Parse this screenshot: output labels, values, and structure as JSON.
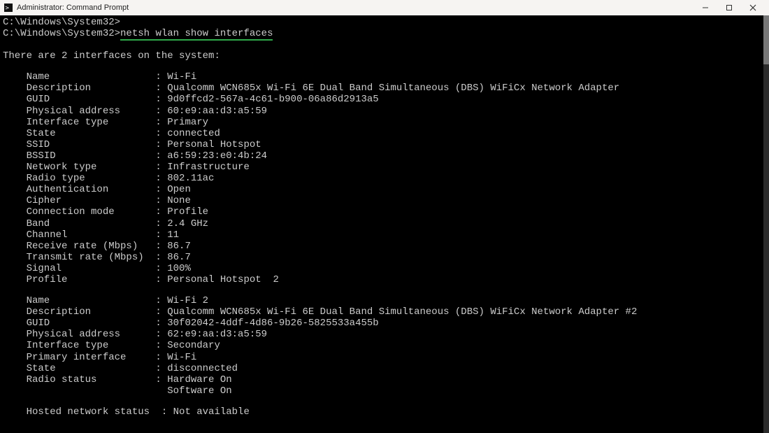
{
  "window": {
    "title": "Administrator: Command Prompt"
  },
  "prompt1": {
    "path": "C:\\Windows\\System32>"
  },
  "prompt2": {
    "path": "C:\\Windows\\System32>",
    "command": "netsh wlan show interfaces"
  },
  "header_line": "There are 2 interfaces on the system:",
  "iface1": {
    "rows": [
      {
        "label": "Name",
        "value": "Wi-Fi"
      },
      {
        "label": "Description",
        "value": "Qualcomm WCN685x Wi-Fi 6E Dual Band Simultaneous (DBS) WiFiCx Network Adapter"
      },
      {
        "label": "GUID",
        "value": "9d0ffcd2-567a-4c61-b900-06a86d2913a5"
      },
      {
        "label": "Physical address",
        "value": "60:e9:aa:d3:a5:59"
      },
      {
        "label": "Interface type",
        "value": "Primary"
      },
      {
        "label": "State",
        "value": "connected"
      },
      {
        "label": "SSID",
        "value": "Personal Hotspot"
      },
      {
        "label": "BSSID",
        "value": "a6:59:23:e0:4b:24"
      },
      {
        "label": "Network type",
        "value": "Infrastructure"
      },
      {
        "label": "Radio type",
        "value": "802.11ac"
      },
      {
        "label": "Authentication",
        "value": "Open"
      },
      {
        "label": "Cipher",
        "value": "None"
      },
      {
        "label": "Connection mode",
        "value": "Profile"
      },
      {
        "label": "Band",
        "value": "2.4 GHz"
      },
      {
        "label": "Channel",
        "value": "11"
      },
      {
        "label": "Receive rate (Mbps)",
        "value": "86.7"
      },
      {
        "label": "Transmit rate (Mbps)",
        "value": "86.7"
      },
      {
        "label": "Signal",
        "value": "100%"
      },
      {
        "label": "Profile",
        "value": "Personal Hotspot  2"
      }
    ]
  },
  "iface2": {
    "rows": [
      {
        "label": "Name",
        "value": "Wi-Fi 2"
      },
      {
        "label": "Description",
        "value": "Qualcomm WCN685x Wi-Fi 6E Dual Band Simultaneous (DBS) WiFiCx Network Adapter #2"
      },
      {
        "label": "GUID",
        "value": "30f02042-4ddf-4d86-9b26-5825533a455b"
      },
      {
        "label": "Physical address",
        "value": "62:e9:aa:d3:a5:59"
      },
      {
        "label": "Interface type",
        "value": "Secondary"
      },
      {
        "label": "Primary interface",
        "value": "Wi-Fi"
      },
      {
        "label": "State",
        "value": "disconnected"
      },
      {
        "label": "Radio status",
        "value": "Hardware On"
      }
    ],
    "extra_line": "Software On"
  },
  "hosted": {
    "label": "Hosted network status",
    "value": "Not available"
  },
  "layout": {
    "indent_field": 4,
    "label_width": 22,
    "sep": ": "
  }
}
